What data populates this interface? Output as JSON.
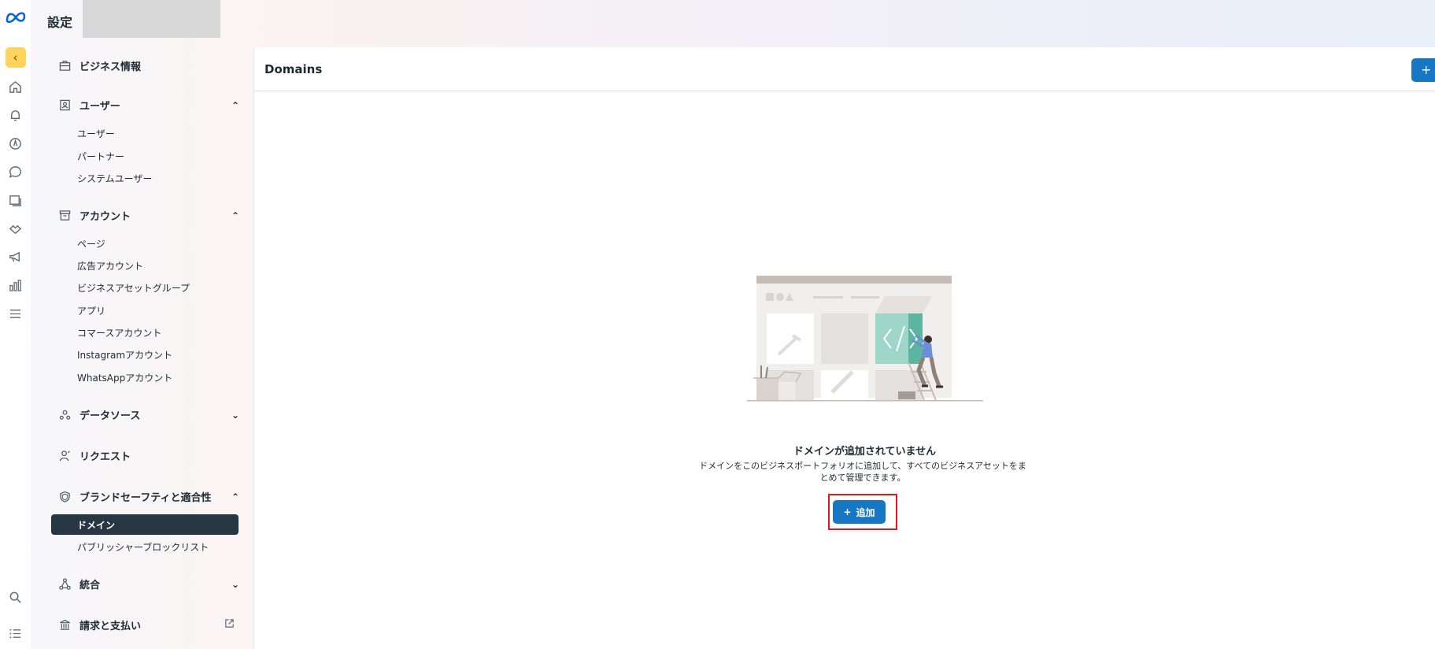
{
  "header": {
    "title": "設定"
  },
  "sidebar": {
    "business_info": "ビジネス情報",
    "users": {
      "label": "ユーザー",
      "items": [
        "ユーザー",
        "パートナー",
        "システムユーザー"
      ]
    },
    "accounts": {
      "label": "アカウント",
      "items": [
        "ページ",
        "広告アカウント",
        "ビジネスアセットグループ",
        "アプリ",
        "コマースアカウント",
        "Instagramアカウント",
        "WhatsAppアカウント"
      ]
    },
    "data_sources": "データソース",
    "requests": "リクエスト",
    "brand_safety": {
      "label": "ブランドセーフティと適合性",
      "items": [
        "ドメイン",
        "パブリッシャーブロックリスト"
      ]
    },
    "integrations": "統合",
    "billing": "請求と支払い"
  },
  "main": {
    "title": "Domains",
    "header_button": "+",
    "empty_title": "ドメインが追加されていません",
    "empty_desc": "ドメインをこのビジネスポートフォリオに追加して、すべてのビジネスアセットをまとめて管理できます。",
    "add_button": "追加",
    "add_icon": "+"
  },
  "colors": {
    "accent": "#1877c5",
    "active_nav": "#263642",
    "highlight": "#e0191b",
    "collapse": "#ffd35c"
  }
}
